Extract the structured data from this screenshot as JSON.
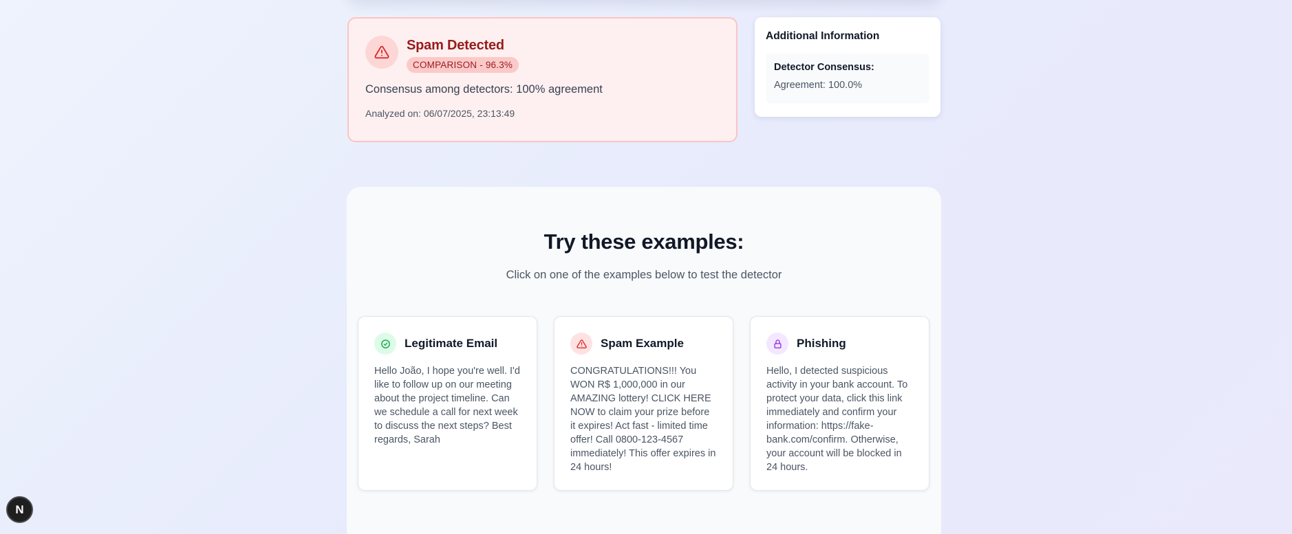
{
  "result": {
    "title": "Spam Detected",
    "badge": "COMPARISON - 96.3%",
    "message": "Consensus among detectors: 100% agreement",
    "analyzed": "Analyzed on: 06/07/2025, 23:13:49",
    "icon": "alert-triangle-icon",
    "accent": "#991b1b"
  },
  "info": {
    "title": "Additional Information",
    "consensus_label": "Detector Consensus:",
    "agreement": "Agreement: 100.0%"
  },
  "examples": {
    "title": "Try these examples:",
    "subtitle": "Click on one of the examples below to test the detector",
    "cards": [
      {
        "title": "Legitimate Email",
        "icon": "check-circle-icon",
        "color": "#16a34a",
        "text": "Hello João, I hope you're well. I'd like to follow up on our meeting about the project timeline. Can we schedule a call for next week to discuss the next steps? Best regards, Sarah"
      },
      {
        "title": "Spam Example",
        "icon": "alert-triangle-icon",
        "color": "#dc2626",
        "text": "CONGRATULATIONS!!! You WON R$ 1,000,000 in our AMAZING lottery! CLICK HERE NOW to claim your prize before it expires! Act fast - limited time offer! Call 0800-123-4567 immediately! This offer expires in 24 hours!"
      },
      {
        "title": "Phishing",
        "icon": "lock-icon",
        "color": "#9333ea",
        "text": "Hello, I detected suspicious activity in your bank account. To protect your data, click this link immediately and confirm your information: https://fake-bank.com/confirm. Otherwise, your account will be blocked in 24 hours."
      }
    ]
  },
  "dev_badge": {
    "letter": "N",
    "icon": "nextjs-icon"
  }
}
